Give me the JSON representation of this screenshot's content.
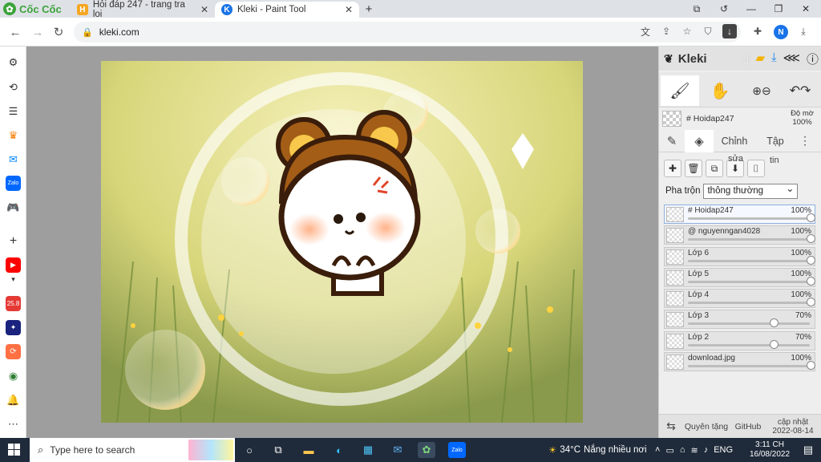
{
  "browser": {
    "brand": "Cốc Cốc",
    "tabs": [
      {
        "title": "Hỏi đáp 247 - trang tra loi",
        "active": false
      },
      {
        "title": "Kleki - Paint Tool",
        "active": true
      }
    ],
    "url": "kleki.com",
    "profile_initial": "N"
  },
  "sidebar_badge": "25.8",
  "app": {
    "name": "Kleki",
    "brush_layer_label": "# Hoidap247",
    "opacity_label_1": "Độ mờ",
    "opacity_label_2": "100%",
    "tabs": [
      "Chỉnh",
      "Tập"
    ],
    "layer_action_sua": "sửa",
    "layer_action_tin": "tin",
    "blend_label": "Pha trộn",
    "blend_value": "thông thường",
    "layers": [
      {
        "name": "# Hoidap247",
        "opacity_label": "100%",
        "opacity": 1.0,
        "selected": true
      },
      {
        "name": "@ nguyenngan4028",
        "opacity_label": "100%",
        "opacity": 1.0,
        "selected": false
      },
      {
        "name": "Lớp 6",
        "opacity_label": "100%",
        "opacity": 1.0,
        "selected": false
      },
      {
        "name": "Lớp 5",
        "opacity_label": "100%",
        "opacity": 1.0,
        "selected": false
      },
      {
        "name": "Lớp 4",
        "opacity_label": "100%",
        "opacity": 1.0,
        "selected": false
      },
      {
        "name": "Lớp 3",
        "opacity_label": "70%",
        "opacity": 0.7,
        "selected": false
      },
      {
        "name": "Lớp 2",
        "opacity_label": "70%",
        "opacity": 0.7,
        "selected": false
      },
      {
        "name": "download.jpg",
        "opacity_label": "100%",
        "opacity": 1.0,
        "selected": false
      }
    ],
    "footer": {
      "privacy": "Quyên tặng",
      "github": "GitHub",
      "update_label": "cập nhật",
      "update_date": "2022-08-14"
    }
  },
  "taskbar": {
    "search_placeholder": "Type here to search",
    "weather_temp": "34°C",
    "weather_text": "Nắng nhiều nơi",
    "lang": "ENG",
    "time": "3:11 CH",
    "date": "16/08/2022"
  }
}
